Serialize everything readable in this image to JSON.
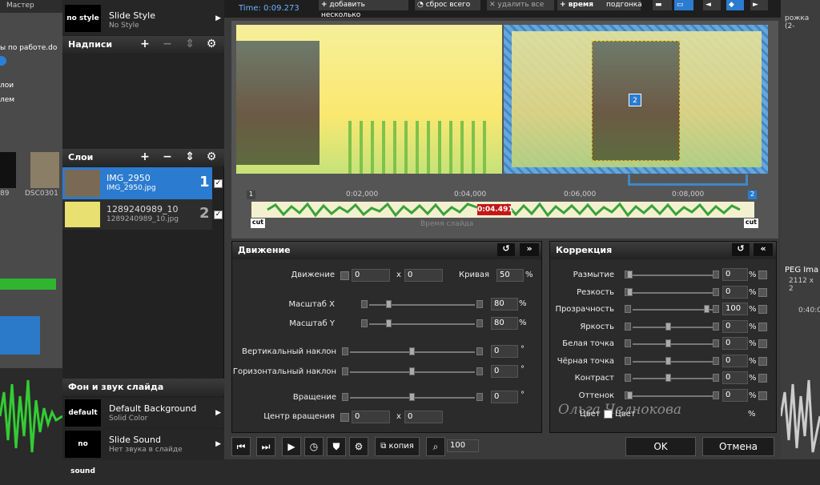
{
  "bg": {
    "master": "Мастер",
    "file": "ы по работе.do",
    "items": [
      "лои",
      "лем"
    ],
    "thumb_name": "DSC0301",
    "left_num": "89",
    "right_top": "рожка (2-",
    "right_jpeg": "PEG Ima",
    "right_size": "2112 x 2",
    "right_time": "0:40:0"
  },
  "top": {
    "time": "Time: 0:09.273",
    "add_several": "добавить несколько",
    "reset_all": "сброс всего",
    "delete_all": "удалить все",
    "time_label": "время",
    "fit": "подгонка"
  },
  "sidebar": {
    "style": {
      "thumb": "no style",
      "title": "Slide Style",
      "sub": "No Style"
    },
    "captions_title": "Надписи",
    "layers_title": "Слои",
    "layers": [
      {
        "name": "IMG_2950",
        "file": "IMG_2950.jpg",
        "num": "1"
      },
      {
        "name": "1289240989_10",
        "file": "1289240989_10.jpg",
        "num": "2"
      }
    ],
    "bgsound_title": "Фон и звук слайда",
    "bg_row": {
      "thumb": "default",
      "title": "Default Background",
      "sub": "Solid Color"
    },
    "sound_row": {
      "thumb": "no sound",
      "title": "Slide Sound",
      "sub": "Нет звука в слайде"
    }
  },
  "timeline": {
    "ticks": [
      "0:02,000",
      "0:04,000",
      "0:06,000",
      "0:08,000"
    ],
    "current": "0:04.491",
    "caption": "Время слайда",
    "cut": "cut",
    "marker_left": "1",
    "marker_right": "2"
  },
  "motion": {
    "title": "Движение",
    "movement": "Движение",
    "mx": "0",
    "x": "x",
    "my": "0",
    "curve": "Кривая",
    "curve_val": "50",
    "pct": "%",
    "scale_x": "Масштаб X",
    "scale_x_val": "80",
    "scale_y": "Масштаб Y",
    "scale_y_val": "80",
    "vtilt": "Вертикальный наклон",
    "vtilt_val": "0",
    "htilt": "Горизонтальный наклон",
    "htilt_val": "0",
    "rotation": "Вращение",
    "rotation_val": "0",
    "center": "Центр вращения",
    "cx": "0",
    "cy": "0",
    "deg": "°"
  },
  "correction": {
    "title": "Коррекция",
    "rows": [
      {
        "label": "Размытие",
        "val": "0"
      },
      {
        "label": "Резкость",
        "val": "0"
      },
      {
        "label": "Прозрачность",
        "val": "100"
      },
      {
        "label": "Яркость",
        "val": "0"
      },
      {
        "label": "Белая точка",
        "val": "0"
      },
      {
        "label": "Чёрная точка",
        "val": "0"
      },
      {
        "label": "Контраст",
        "val": "0"
      },
      {
        "label": "Оттенок",
        "val": "0"
      }
    ],
    "color1": "Цвет",
    "color2": "Цвет",
    "pct": "%"
  },
  "bottom": {
    "copy": "копия",
    "zoom": "100",
    "ok": "OK",
    "cancel": "Отмена"
  },
  "watermark": "Ольга Челнокова"
}
